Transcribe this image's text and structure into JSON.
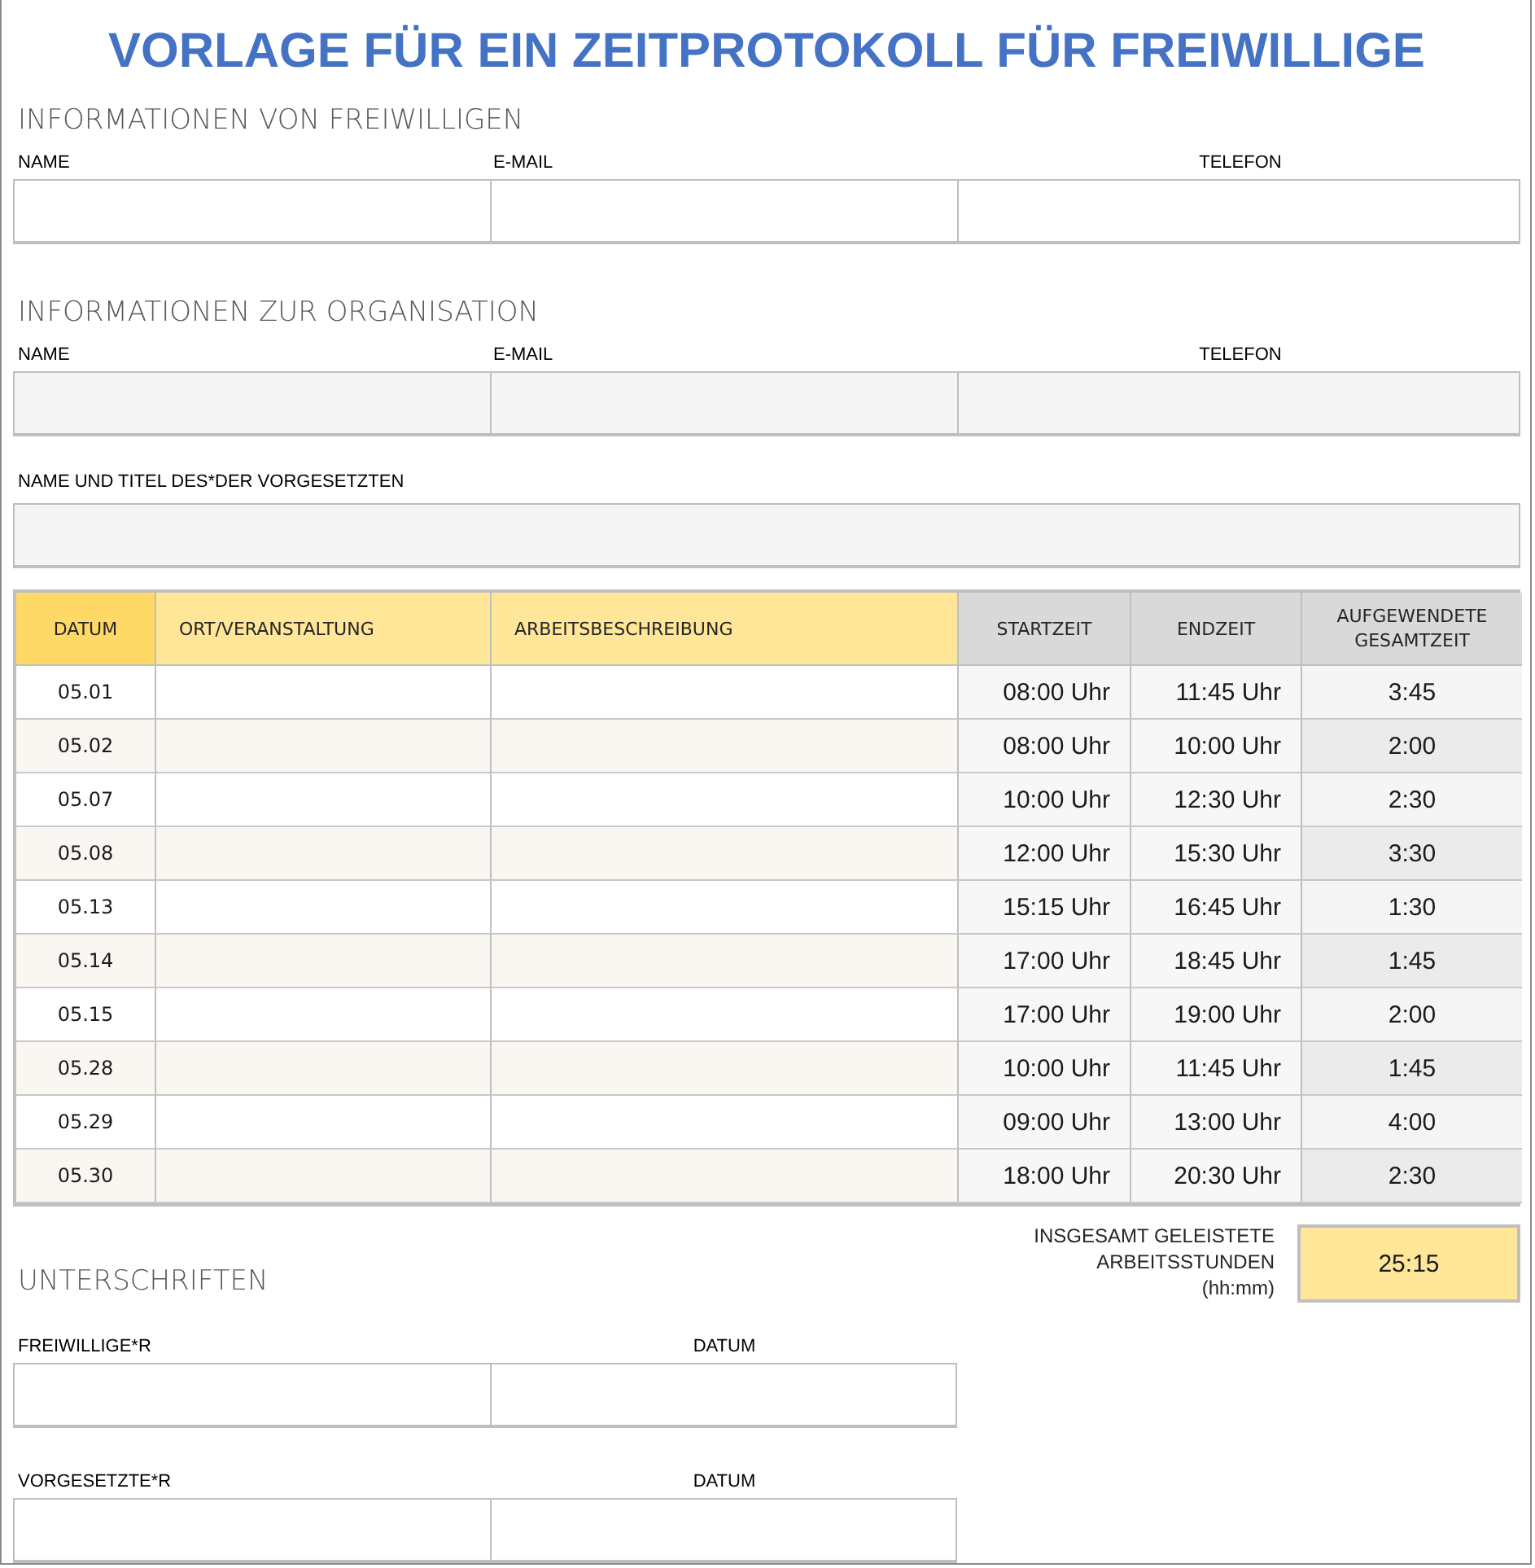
{
  "title": "VORLAGE FÜR EIN ZEITPROTOKOLL FÜR FREIWILLIGE",
  "volunteer_info": {
    "heading": "INFORMATIONEN VON FREIWILLIGEN",
    "fields": [
      "NAME",
      "E-MAIL",
      "TELEFON"
    ]
  },
  "organization_info": {
    "heading": "INFORMATIONEN ZUR ORGANISATION",
    "fields": [
      "NAME",
      "E-MAIL",
      "TELEFON"
    ]
  },
  "supervisor": {
    "label": "NAME UND TITEL DES*DER VORGESETZTEN"
  },
  "table": {
    "columns": [
      {
        "label": "DATUM",
        "kind": "date"
      },
      {
        "label": "ORT/VERANSTALTUNG",
        "kind": "text"
      },
      {
        "label": "ARBEITSBESCHREIBUNG",
        "kind": "text"
      },
      {
        "label": "STARTZEIT",
        "kind": "time"
      },
      {
        "label": "ENDZEIT",
        "kind": "time"
      },
      {
        "label": "AUFGEWENDETE GESAMTZEIT",
        "kind": "total"
      }
    ],
    "rows": [
      {
        "date": "05.01",
        "start": "08:00 Uhr",
        "end": "11:45 Uhr",
        "total": "3:45"
      },
      {
        "date": "05.02",
        "start": "08:00 Uhr",
        "end": "10:00 Uhr",
        "total": "2:00"
      },
      {
        "date": "05.07",
        "start": "10:00 Uhr",
        "end": "12:30 Uhr",
        "total": "2:30"
      },
      {
        "date": "05.08",
        "start": "12:00 Uhr",
        "end": "15:30 Uhr",
        "total": "3:30"
      },
      {
        "date": "05.13",
        "start": "15:15 Uhr",
        "end": "16:45 Uhr",
        "total": "1:30"
      },
      {
        "date": "05.14",
        "start": "17:00 Uhr",
        "end": "18:45 Uhr",
        "total": "1:45"
      },
      {
        "date": "05.15",
        "start": "17:00 Uhr",
        "end": "19:00 Uhr",
        "total": "2:00"
      },
      {
        "date": "05.28",
        "start": "10:00 Uhr",
        "end": "11:45 Uhr",
        "total": "1:45"
      },
      {
        "date": "05.29",
        "start": "09:00 Uhr",
        "end": "13:00 Uhr",
        "total": "4:00"
      },
      {
        "date": "05.30",
        "start": "18:00 Uhr",
        "end": "20:30 Uhr",
        "total": "2:30"
      }
    ]
  },
  "totals": {
    "label_lines": [
      "INSGESAMT GELEISTETE",
      "ARBEITSSTUNDEN",
      "(hh:mm)"
    ],
    "value": "25:15"
  },
  "signatures": {
    "heading": "UNTERSCHRIFTEN",
    "rows": [
      {
        "label": "FREIWILLIGE*R",
        "date_label": "DATUM"
      },
      {
        "label": "VORGESETZTE*R",
        "date_label": "DATUM"
      }
    ]
  }
}
